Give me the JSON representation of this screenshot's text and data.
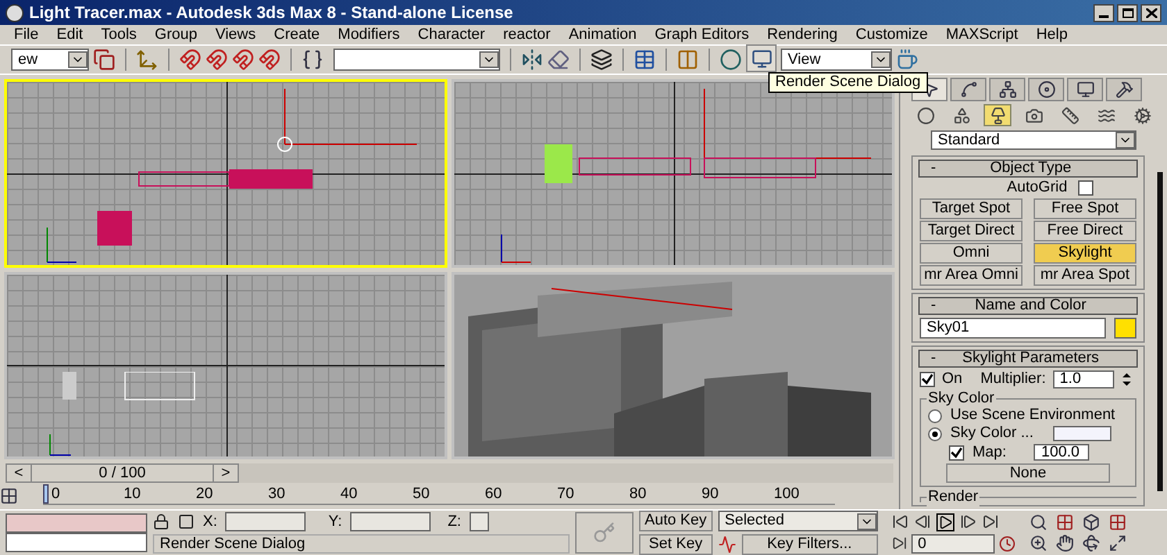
{
  "window": {
    "title": "Light Tracer.max - Autodesk 3ds Max 8  - Stand-alone License"
  },
  "menu": [
    "File",
    "Edit",
    "Tools",
    "Group",
    "Views",
    "Create",
    "Modifiers",
    "Character",
    "reactor",
    "Animation",
    "Graph Editors",
    "Rendering",
    "Customize",
    "MAXScript",
    "Help"
  ],
  "toolbar": {
    "selection_filter": "ew",
    "render_type": "View",
    "tooltip": "Render Scene Dialog"
  },
  "viewports": [
    {
      "kind": "top",
      "selected": true
    },
    {
      "kind": "front",
      "selected": false
    },
    {
      "kind": "left",
      "selected": false
    },
    {
      "kind": "perspective",
      "selected": false
    }
  ],
  "command_panel": {
    "tabs": [
      {
        "selected": true
      },
      {
        "selected": false
      },
      {
        "selected": false
      },
      {
        "selected": false
      },
      {
        "selected": false
      },
      {
        "selected": false
      }
    ],
    "categories": [
      {
        "selected": false
      },
      {
        "selected": false
      },
      {
        "selected": true
      },
      {
        "selected": false
      },
      {
        "selected": false
      },
      {
        "selected": false
      },
      {
        "selected": false
      }
    ],
    "type_dropdown": "Standard",
    "object_type": {
      "sign": "-",
      "title": "Object Type",
      "autogrid_label": "AutoGrid",
      "autogrid_checked": false,
      "buttons": [
        {
          "label": "Target Spot",
          "selected": false
        },
        {
          "label": "Free Spot",
          "selected": false
        },
        {
          "label": "Target Direct",
          "selected": false
        },
        {
          "label": "Free Direct",
          "selected": false
        },
        {
          "label": "Omni",
          "selected": false
        },
        {
          "label": "Skylight",
          "selected": true
        },
        {
          "label": "mr Area Omni",
          "selected": false
        },
        {
          "label": "mr Area Spot",
          "selected": false
        }
      ]
    },
    "name_and_color": {
      "sign": "-",
      "title": "Name and Color",
      "name": "Sky01"
    },
    "skylight_parameters": {
      "sign": "-",
      "title": "Skylight Parameters",
      "on_label": "On",
      "on_checked": true,
      "multiplier_label": "Multiplier:",
      "multiplier": "1.0",
      "sky_color_group": "Sky Color",
      "radios": [
        {
          "label": "Use Scene Environment",
          "selected": false
        },
        {
          "label": "Sky Color ...",
          "selected": true
        }
      ],
      "map_label": "Map:",
      "map_checked": true,
      "map_value": "100.0",
      "map_button": "None",
      "render_group": "Render"
    }
  },
  "time_slider": {
    "prev": "<",
    "label": "0 / 100",
    "next": ">",
    "level": 0
  },
  "ruler": [
    "0",
    "10",
    "20",
    "30",
    "40",
    "50",
    "60",
    "70",
    "80",
    "90",
    "100"
  ],
  "status": {
    "x_label": "X:",
    "y_label": "Y:",
    "z_label": "Z:",
    "prompt": "Render Scene Dialog",
    "auto_key": "Auto Key",
    "set_key": "Set Key",
    "key_mode": "Selected",
    "key_filters": "Key Filters...",
    "frame": "0"
  }
}
